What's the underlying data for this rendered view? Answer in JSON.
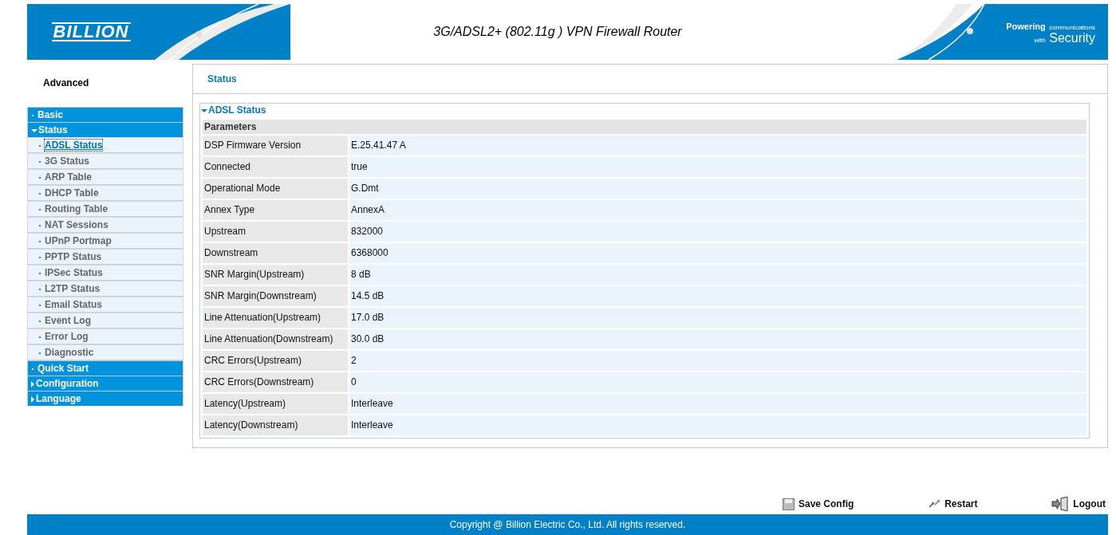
{
  "header": {
    "logo": "BILLION",
    "title": "3G/ADSL2+ (802.11g ) VPN Firewall Router",
    "tagline": {
      "powering": "Powering",
      "communications": "communications",
      "with": "with",
      "security": "Security"
    }
  },
  "sidebar": {
    "heading": "Advanced",
    "items": [
      {
        "label": "Basic",
        "kind": "link"
      },
      {
        "label": "Status",
        "kind": "folder",
        "expanded": true,
        "children": [
          {
            "label": "ADSL Status",
            "selected": true
          },
          {
            "label": "3G Status",
            "selected": false
          },
          {
            "label": "ARP Table",
            "selected": false
          },
          {
            "label": "DHCP Table",
            "selected": false
          },
          {
            "label": "Routing Table",
            "selected": false
          },
          {
            "label": "NAT Sessions",
            "selected": false
          },
          {
            "label": "UPnP Portmap",
            "selected": false
          },
          {
            "label": "PPTP Status",
            "selected": false
          },
          {
            "label": "IPSec Status",
            "selected": false
          },
          {
            "label": "L2TP Status",
            "selected": false
          },
          {
            "label": "Email Status",
            "selected": false
          },
          {
            "label": "Event Log",
            "selected": false
          },
          {
            "label": "Error Log",
            "selected": false
          },
          {
            "label": "Diagnostic",
            "selected": false
          }
        ]
      },
      {
        "label": "Quick Start",
        "kind": "link"
      },
      {
        "label": "Configuration",
        "kind": "folder",
        "expanded": false
      },
      {
        "label": "Language",
        "kind": "folder",
        "expanded": false
      }
    ]
  },
  "panel": {
    "title": "Status",
    "section": {
      "title": "ADSL Status",
      "expanded": true,
      "header": "Parameters",
      "rows": [
        {
          "name": "DSP Firmware Version",
          "value": "E.25.41.47 A"
        },
        {
          "name": "Connected",
          "value": "true"
        },
        {
          "name": "Operational Mode",
          "value": "G.Dmt"
        },
        {
          "name": "Annex Type",
          "value": "AnnexA"
        },
        {
          "name": "Upstream",
          "value": "832000"
        },
        {
          "name": "Downstream",
          "value": "6368000"
        },
        {
          "name": "SNR Margin(Upstream)",
          "value": "8 dB"
        },
        {
          "name": "SNR Margin(Downstream)",
          "value": "14.5 dB"
        },
        {
          "name": "Line Attenuation(Upstream)",
          "value": "17.0 dB"
        },
        {
          "name": "Line Attenuation(Downstream)",
          "value": "30.0 dB"
        },
        {
          "name": "CRC Errors(Upstream)",
          "value": "2"
        },
        {
          "name": "CRC Errors(Downstream)",
          "value": "0"
        },
        {
          "name": "Latency(Upstream)",
          "value": "Interleave"
        },
        {
          "name": "Latency(Downstream)",
          "value": "Interleave"
        }
      ]
    }
  },
  "actions": [
    {
      "label": "Save Config",
      "kind": "save"
    },
    {
      "label": "Restart",
      "kind": "restart"
    },
    {
      "label": "Logout",
      "kind": "logout"
    }
  ],
  "footer": "Copyright @ Billion Electric Co., Ltd. All rights reserved."
}
